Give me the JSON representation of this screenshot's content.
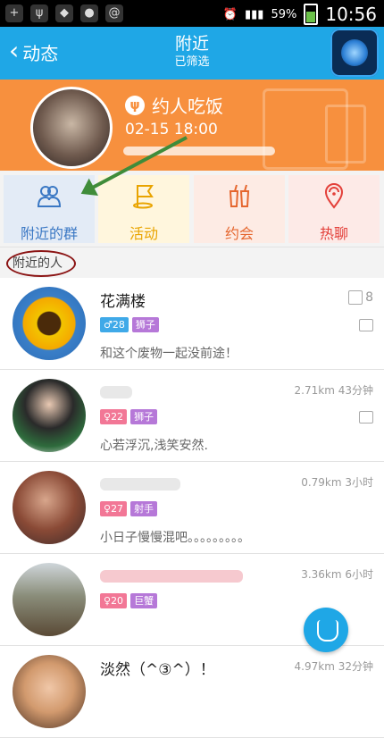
{
  "statusbar": {
    "battery": "59%",
    "time": "10:56"
  },
  "header": {
    "back_label": "动态",
    "title": "附近",
    "subtitle": "已筛选"
  },
  "banner": {
    "tag": "约人吃饭",
    "time": "02-15 18:00"
  },
  "tiles": [
    {
      "label": "附近的群"
    },
    {
      "label": "活动"
    },
    {
      "label": "约会"
    },
    {
      "label": "热聊"
    }
  ],
  "section": {
    "title": "附近的人"
  },
  "people": [
    {
      "name": "花满楼",
      "age": "28",
      "zodiac": "狮子",
      "signature": "和这个废物一起没前途！",
      "meta": "",
      "likes": "8"
    },
    {
      "name": "",
      "age": "22",
      "zodiac": "狮子",
      "signature": "心若浮沉,浅笑安然.",
      "meta": "2.71km 43分钟",
      "likes": ""
    },
    {
      "name": "",
      "age": "27",
      "zodiac": "射手",
      "signature": "小日子慢慢混吧。。。。。。。。。",
      "meta": "0.79km 3小时",
      "likes": ""
    },
    {
      "name": "",
      "age": "20",
      "zodiac": "巨蟹",
      "signature": "",
      "meta": "3.36km 6小时",
      "likes": ""
    },
    {
      "name": "淡然（^③^）！",
      "age": "",
      "zodiac": "",
      "signature": "",
      "meta": "4.97km 32分钟",
      "likes": ""
    }
  ],
  "colors": {
    "accent": "#1fa7e6",
    "banner": "#f7903e",
    "male": "#3fa9e8",
    "female": "#f27796",
    "zodiac": "#b678d8"
  }
}
